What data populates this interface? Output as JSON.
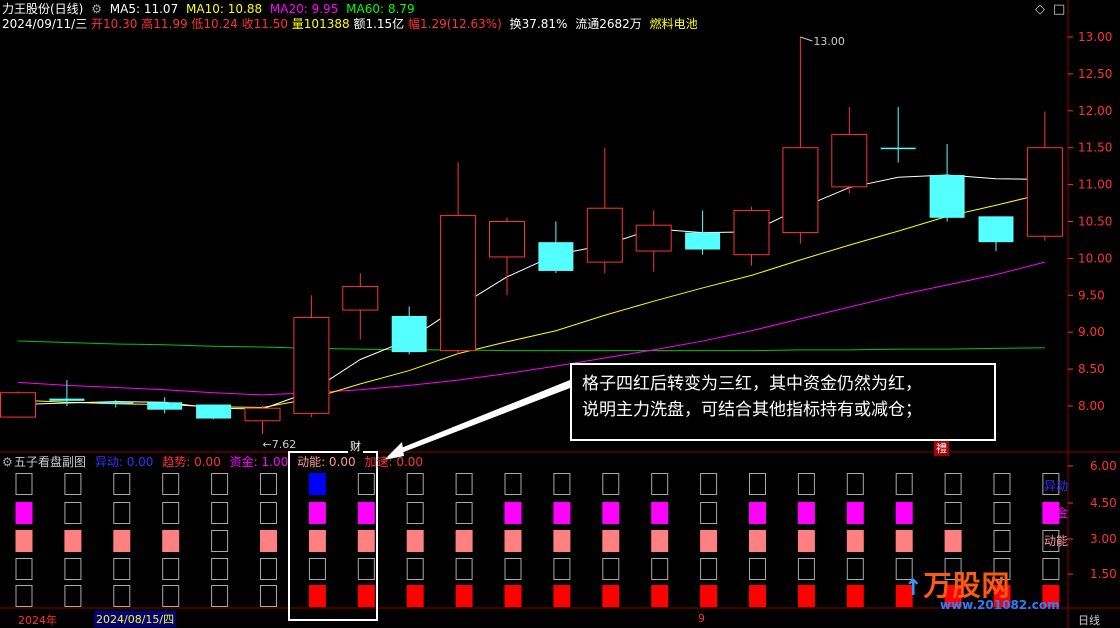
{
  "header": {
    "title": "力王股份(日线)",
    "ma": [
      {
        "label": "MA5: 11.07",
        "color": "#ffffff"
      },
      {
        "label": "MA10: 10.88",
        "color": "#ffff00"
      },
      {
        "label": "MA20: 9.95",
        "color": "#ff00ff"
      },
      {
        "label": "MA60: 8.79",
        "color": "#00ff00"
      }
    ],
    "line2": {
      "date": "2024/09/11/三",
      "open": "开10.30",
      "high": "高11.99",
      "low": "低10.24",
      "close": "收11.50",
      "vol": "量101388",
      "amount": "额1.15亿",
      "amp": "幅1.29(12.63%)",
      "turnover": "换37.81%",
      "float": "流通2682万",
      "sector": "燃料电池"
    }
  },
  "price_axis": [
    "13.00",
    "12.50",
    "12.00",
    "11.50",
    "11.00",
    "10.50",
    "10.00",
    "9.50",
    "9.00",
    "8.50",
    "8.00"
  ],
  "high_label": "13.00",
  "low_label": "7.62",
  "tags": {
    "cai": "财",
    "jiang": "禮"
  },
  "callout": {
    "line1": "格子四红后转变为三红，其中资金仍然为红，",
    "line2": "说明主力洗盘，可结合其他指标持有或减仓；"
  },
  "sub": {
    "title": "五子看盘副图",
    "items": [
      {
        "label": "异动: 0.00",
        "color": "#0000ff"
      },
      {
        "label": "趋势: 0.00",
        "color": "#ff3333"
      },
      {
        "label": "资金: 1.00",
        "color": "#ff00ff"
      },
      {
        "label": "动能: 0.00",
        "color": "#ff9999"
      },
      {
        "label": "加速: 0.00",
        "color": "#ff0000"
      }
    ],
    "axis": [
      "6.00",
      "4.50",
      "3.00",
      "1.50"
    ],
    "right_labels": [
      "异动",
      "资金",
      "动能"
    ]
  },
  "bottom": {
    "year": "2024年",
    "date": "2024/08/15/四",
    "mark": "9",
    "period": "日线"
  },
  "watermark": {
    "brand": "万股网",
    "url": "www.201082.com"
  },
  "colors": {
    "up": "#ff3232",
    "down": "#54ffff",
    "bg": "#000000",
    "grid": "#8b0000"
  },
  "chart_data": {
    "type": "candlestick",
    "ylim": [
      7.5,
      13.3
    ],
    "candles": [
      {
        "o": 7.85,
        "h": 8.2,
        "l": 7.85,
        "c": 8.18
      },
      {
        "o": 8.1,
        "h": 8.35,
        "l": 8.0,
        "c": 8.07
      },
      {
        "o": 8.05,
        "h": 8.08,
        "l": 7.98,
        "c": 8.03
      },
      {
        "o": 8.05,
        "h": 8.12,
        "l": 7.9,
        "c": 7.95
      },
      {
        "o": 8.02,
        "h": 8.02,
        "l": 7.82,
        "c": 7.83
      },
      {
        "o": 7.8,
        "h": 8.0,
        "l": 7.62,
        "c": 7.97
      },
      {
        "o": 7.9,
        "h": 9.5,
        "l": 7.85,
        "c": 9.2
      },
      {
        "o": 9.3,
        "h": 9.8,
        "l": 8.9,
        "c": 9.62
      },
      {
        "o": 9.22,
        "h": 9.35,
        "l": 8.7,
        "c": 8.73
      },
      {
        "o": 8.75,
        "h": 11.3,
        "l": 8.7,
        "c": 10.58
      },
      {
        "o": 10.02,
        "h": 10.55,
        "l": 9.5,
        "c": 10.5
      },
      {
        "o": 10.22,
        "h": 10.5,
        "l": 9.8,
        "c": 9.83
      },
      {
        "o": 9.95,
        "h": 11.5,
        "l": 9.8,
        "c": 10.68
      },
      {
        "o": 10.1,
        "h": 10.65,
        "l": 9.82,
        "c": 10.45
      },
      {
        "o": 10.35,
        "h": 10.65,
        "l": 10.05,
        "c": 10.12
      },
      {
        "o": 10.05,
        "h": 10.7,
        "l": 9.9,
        "c": 10.65
      },
      {
        "o": 10.35,
        "h": 13.0,
        "l": 10.2,
        "c": 11.5
      },
      {
        "o": 10.97,
        "h": 12.05,
        "l": 10.88,
        "c": 11.68
      },
      {
        "o": 11.5,
        "h": 12.05,
        "l": 11.3,
        "c": 11.48
      },
      {
        "o": 11.13,
        "h": 11.55,
        "l": 10.5,
        "c": 10.55
      },
      {
        "o": 10.57,
        "h": 10.55,
        "l": 10.1,
        "c": 10.22
      },
      {
        "o": 10.3,
        "h": 11.99,
        "l": 10.24,
        "c": 11.5
      }
    ],
    "ma5": [
      8.02,
      8.04,
      8.06,
      8.05,
      7.97,
      7.96,
      8.2,
      8.63,
      8.9,
      9.34,
      9.75,
      10.05,
      10.18,
      10.4,
      10.35,
      10.36,
      10.68,
      10.96,
      11.1,
      11.13,
      11.08,
      11.07
    ],
    "ma10": [
      8.08,
      8.05,
      8.03,
      8.02,
      7.99,
      7.98,
      8.1,
      8.3,
      8.48,
      8.71,
      8.87,
      9.02,
      9.23,
      9.42,
      9.6,
      9.77,
      9.98,
      10.18,
      10.37,
      10.57,
      10.72,
      10.88
    ],
    "ma20": [
      8.32,
      8.28,
      8.25,
      8.22,
      8.18,
      8.15,
      8.18,
      8.22,
      8.28,
      8.35,
      8.44,
      8.54,
      8.65,
      8.76,
      8.88,
      9.02,
      9.18,
      9.34,
      9.5,
      9.64,
      9.78,
      9.95
    ],
    "ma60": [
      8.88,
      8.86,
      8.84,
      8.83,
      8.81,
      8.8,
      8.78,
      8.77,
      8.76,
      8.76,
      8.75,
      8.75,
      8.75,
      8.75,
      8.75,
      8.75,
      8.76,
      8.76,
      8.77,
      8.77,
      8.78,
      8.79
    ],
    "grid_rows": [
      {
        "name": "异动",
        "active": [
          6
        ]
      },
      {
        "name": "资金",
        "active": [
          0,
          6,
          7,
          10,
          11,
          12,
          13,
          15,
          16,
          17,
          18,
          21
        ]
      },
      {
        "name": "动能",
        "active": [
          0,
          1,
          2,
          3,
          5,
          6,
          7,
          8,
          9,
          10,
          11,
          12,
          13,
          14,
          15,
          16,
          17,
          18,
          19
        ]
      },
      {
        "name": "趋势",
        "active": []
      },
      {
        "name": "加速",
        "active": [
          6,
          7,
          8,
          9,
          10,
          11,
          12,
          13,
          14,
          15,
          16,
          17,
          18,
          19,
          20,
          21
        ]
      }
    ]
  }
}
